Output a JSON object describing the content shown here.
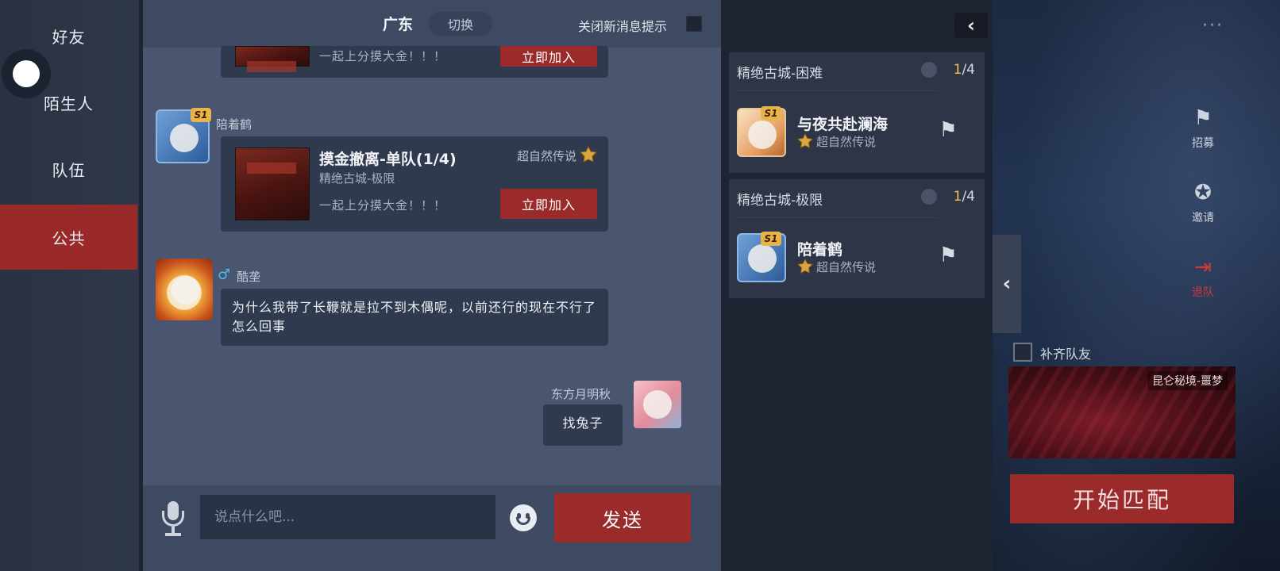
{
  "nav": {
    "items": [
      {
        "label": "好友"
      },
      {
        "label": "陌生人"
      },
      {
        "label": "队伍"
      },
      {
        "label": "公共"
      }
    ]
  },
  "chat": {
    "header": {
      "region": "广东",
      "switch_label": "切换",
      "mute_label": "关闭新消息提示"
    },
    "messages": [
      {
        "type": "team_card",
        "desc": "一起上分摸大金！！！",
        "join_label": "立即加入"
      },
      {
        "type": "team_card",
        "sender": "陪着鹤",
        "badge": "S1",
        "title": "摸金撤离-单队(1/4)",
        "sub": "精绝古城-极限",
        "tier": "超自然传说",
        "desc": "一起上分摸大金！！！",
        "join_label": "立即加入"
      },
      {
        "type": "text",
        "sender": "酷垄",
        "gender_icon": "♂",
        "text": "为什么我带了长鞭就是拉不到木偶呢，以前还行的现在不行了怎么回事"
      },
      {
        "type": "text_self",
        "sender": "东方月明秋",
        "text": "找兔子"
      }
    ],
    "input": {
      "placeholder": "说点什么吧...",
      "send_label": "发送"
    }
  },
  "teams": [
    {
      "header": "精绝古城-困难",
      "count_current": "1",
      "count_total": "/4",
      "player": "与夜共赴澜海",
      "badge": "S1",
      "rank": "超自然传说"
    },
    {
      "header": "精绝古城-极限",
      "count_current": "1",
      "count_total": "/4",
      "player": "陪着鹤",
      "badge": "S1",
      "rank": "超自然传说"
    }
  ],
  "side": {
    "actions": [
      {
        "label": "招募",
        "icon": "flag-icon"
      },
      {
        "label": "邀请",
        "icon": "medal-icon"
      },
      {
        "label": "退队",
        "icon": "exit-icon"
      }
    ],
    "fill_label": "补齐队友",
    "mode_name": "昆仑秘境-噩梦",
    "start_label": "开始匹配"
  },
  "colors": {
    "accent_red": "#9b2a2a",
    "count_highlight": "#e8c25a",
    "male_blue": "#4db8f0"
  }
}
